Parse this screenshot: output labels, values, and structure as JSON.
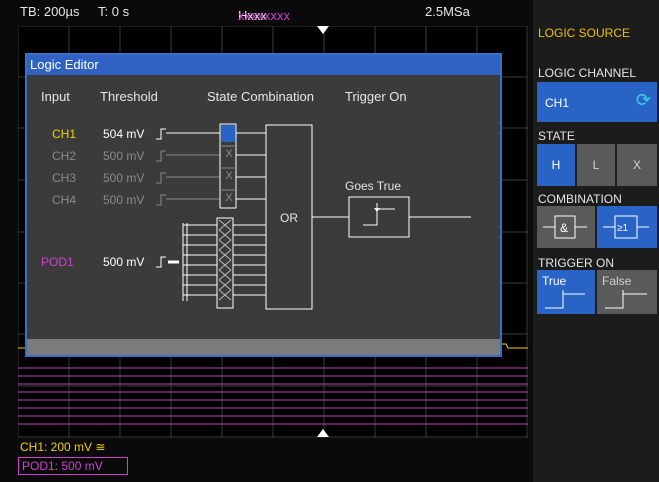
{
  "status": {
    "timebase": "TB: 200µs",
    "trigger_time": "T: 0 s",
    "hname_prefix": "Hxxx",
    "hname_suffix": "xxxxxxxx",
    "sample_rate": "2.5MSa"
  },
  "editor": {
    "title": "Logic Editor",
    "col_input": "Input",
    "col_threshold": "Threshold",
    "col_state": "State Combination",
    "col_trigger": "Trigger On",
    "rows": [
      {
        "input": "CH1",
        "threshold": "504 mV",
        "state": "H",
        "active": true
      },
      {
        "input": "CH2",
        "threshold": "500 mV",
        "state": "X",
        "active": false
      },
      {
        "input": "CH3",
        "threshold": "500 mV",
        "state": "X",
        "active": false
      },
      {
        "input": "CH4",
        "threshold": "500 mV",
        "state": "X",
        "active": false
      }
    ],
    "pod": {
      "input": "POD1",
      "threshold": "500 mV"
    },
    "gate": "OR",
    "trigger_label": "Goes True"
  },
  "sidebar": {
    "title": "LOGIC SOURCE",
    "logic_channel_label": "LOGIC CHANNEL",
    "logic_channel_value": "CH1",
    "state_label": "STATE",
    "state_options": [
      "H",
      "L",
      "X"
    ],
    "state_selected": "H",
    "combination_label": "COMBINATION",
    "combination_options": [
      "&",
      "≥1"
    ],
    "combination_selected": "≥1",
    "trigger_on_label": "TRIGGER ON",
    "trigger_options": [
      "True",
      "False"
    ],
    "trigger_selected": "True"
  },
  "bottom": {
    "ch1_info": "CH1: 200 mV ≅",
    "pod1_info": "POD1: 500 mV"
  },
  "colors": {
    "accent": "#2a63c6",
    "ch1": "#f0d000",
    "pod": "#d040d0"
  }
}
